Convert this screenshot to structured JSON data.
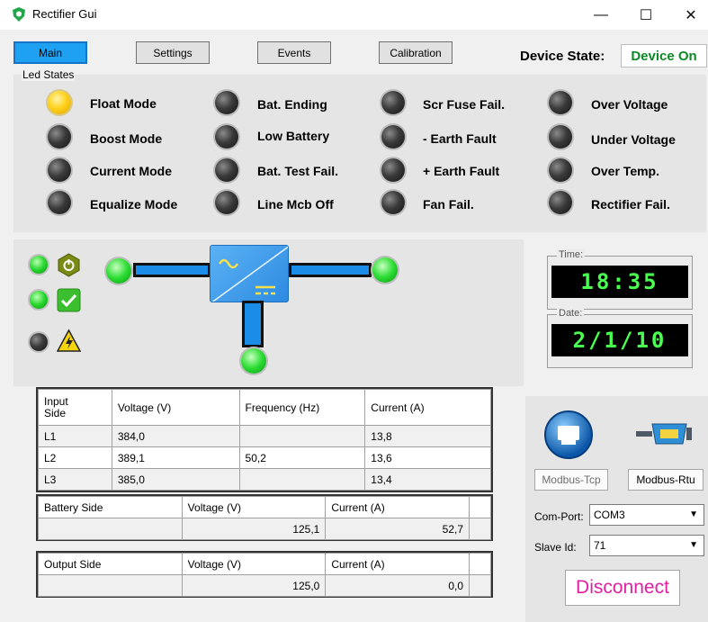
{
  "window": {
    "title": "Rectifier Gui",
    "minimize": "—",
    "maximize": "☐",
    "close": "✕"
  },
  "tabs": [
    {
      "label": "Main"
    },
    {
      "label": "Settings"
    },
    {
      "label": "Events"
    },
    {
      "label": "Calibration"
    }
  ],
  "device_state": {
    "label": "Device State:",
    "value": "Device On",
    "value_color": "#0b8a24"
  },
  "led_states": {
    "caption": "Led States",
    "items": [
      {
        "label": "Float Mode",
        "on": true
      },
      {
        "label": "Boost Mode",
        "on": false
      },
      {
        "label": "Current Mode",
        "on": false
      },
      {
        "label": "Equalize Mode",
        "on": false
      },
      {
        "label": "Bat. Ending",
        "on": false
      },
      {
        "label": "Low Battery",
        "on": false
      },
      {
        "label": "Bat. Test Fail.",
        "on": false
      },
      {
        "label": "Line Mcb Off",
        "on": false
      },
      {
        "label": "Scr Fuse Fail.",
        "on": false
      },
      {
        "label": "- Earth Fault",
        "on": false
      },
      {
        "label": "+ Earth Fault",
        "on": false
      },
      {
        "label": "Fan Fail.",
        "on": false
      },
      {
        "label": "Over Voltage",
        "on": false
      },
      {
        "label": "Under Voltage",
        "on": false
      },
      {
        "label": "Over Temp.",
        "on": false
      },
      {
        "label": "Rectifier Fail.",
        "on": false
      }
    ]
  },
  "clock": {
    "time_caption": "Time:",
    "time": "18:35",
    "date_caption": "Date:",
    "date": "2/1/10"
  },
  "input_table": {
    "headers": [
      "Input\nSide",
      "Voltage (V)",
      "Frequency (Hz)",
      "Current (A)"
    ],
    "rows": [
      [
        "L1",
        "384,0",
        "",
        "13,8"
      ],
      [
        "L2",
        "389,1",
        "50,2",
        "13,6"
      ],
      [
        "L3",
        "385,0",
        "",
        "13,4"
      ]
    ]
  },
  "battery_table": {
    "headers": [
      "Battery Side",
      "Voltage (V)",
      "Current (A)"
    ],
    "values": [
      "",
      "125,1",
      "52,7"
    ]
  },
  "output_table": {
    "headers": [
      "Output Side",
      "Voltage (V)",
      "Current (A)"
    ],
    "values": [
      "",
      "125,0",
      "0,0"
    ]
  },
  "connection": {
    "modbus_tcp": "Modbus-Tcp",
    "modbus_rtu": "Modbus-Rtu",
    "com_port_label": "Com-Port:",
    "com_port_value": "COM3",
    "slave_id_label": "Slave Id:",
    "slave_id_value": "71",
    "disconnect": "Disconnect"
  },
  "colors": {
    "accent_tab": "#1ea1f1",
    "pipe": "#1b8de8",
    "disconnect_text": "#e020a0",
    "clock_digits": "#49ff4f"
  }
}
